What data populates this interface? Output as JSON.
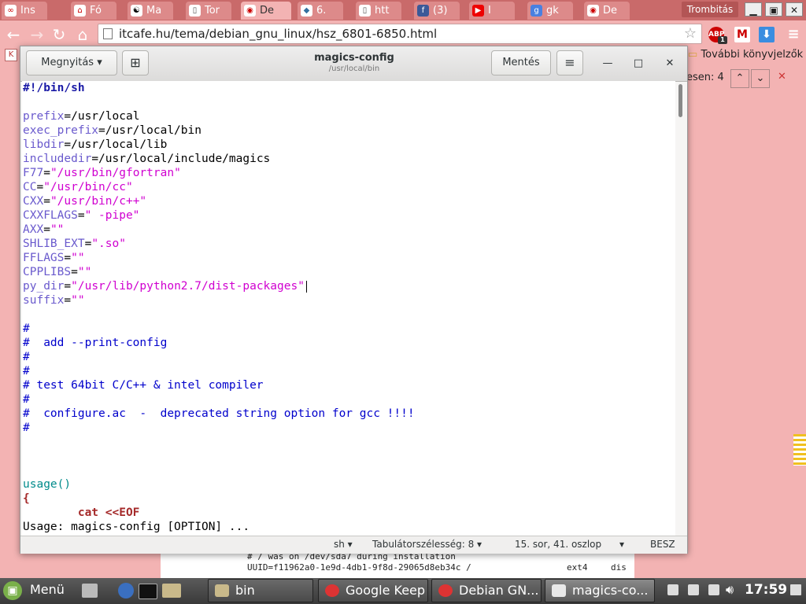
{
  "browser": {
    "tabs": [
      {
        "label": "Ins",
        "icon": "infinity-icon"
      },
      {
        "label": "Fó",
        "icon": "home-flag-icon"
      },
      {
        "label": "Ma",
        "icon": "debian-swirl-icon"
      },
      {
        "label": "Tor",
        "icon": "document-icon"
      },
      {
        "label": "De",
        "icon": "debian-icon"
      },
      {
        "label": "6.",
        "icon": "python-icon"
      },
      {
        "label": "htt",
        "icon": "document-icon"
      },
      {
        "label": "(3)",
        "icon": "facebook-icon"
      },
      {
        "label": "I",
        "icon": "youtube-icon"
      },
      {
        "label": "gk",
        "icon": "google-icon"
      },
      {
        "label": "De",
        "icon": "debian-icon"
      }
    ],
    "profile": "Trombitás",
    "url": "itcafe.hu/tema/debian_gnu_linux/hsz_6801-6850.html",
    "extensions": {
      "abp": "ABP",
      "abp_count": "1"
    },
    "bookmarks_label": "További könyvjelzők",
    "find_label": "esen: 4",
    "accent": "#f3b3b3"
  },
  "editor": {
    "open_button": "Megnyitás",
    "title": "magics-config",
    "subtitle": "/usr/local/bin",
    "save_button": "Mentés",
    "lines": [
      {
        "parts": [
          {
            "t": "#!/bin/sh",
            "c": "shebang"
          }
        ]
      },
      {
        "parts": []
      },
      {
        "parts": [
          {
            "t": "prefix",
            "c": "var"
          },
          {
            "t": "=/usr/local",
            "c": "plain"
          }
        ]
      },
      {
        "parts": [
          {
            "t": "exec_prefix",
            "c": "var"
          },
          {
            "t": "=/usr/local/bin",
            "c": "plain"
          }
        ]
      },
      {
        "parts": [
          {
            "t": "libdir",
            "c": "var"
          },
          {
            "t": "=/usr/local/lib",
            "c": "plain"
          }
        ]
      },
      {
        "parts": [
          {
            "t": "includedir",
            "c": "var"
          },
          {
            "t": "=/usr/local/include/magics",
            "c": "plain"
          }
        ]
      },
      {
        "parts": [
          {
            "t": "F77",
            "c": "var"
          },
          {
            "t": "=",
            "c": "plain"
          },
          {
            "t": "\"/usr/bin/gfortran\"",
            "c": "str"
          }
        ]
      },
      {
        "parts": [
          {
            "t": "CC",
            "c": "var"
          },
          {
            "t": "=",
            "c": "plain"
          },
          {
            "t": "\"/usr/bin/cc\"",
            "c": "str"
          }
        ]
      },
      {
        "parts": [
          {
            "t": "CXX",
            "c": "var"
          },
          {
            "t": "=",
            "c": "plain"
          },
          {
            "t": "\"/usr/bin/c++\"",
            "c": "str"
          }
        ]
      },
      {
        "parts": [
          {
            "t": "CXXFLAGS",
            "c": "var"
          },
          {
            "t": "=",
            "c": "plain"
          },
          {
            "t": "\" -pipe\"",
            "c": "str"
          }
        ]
      },
      {
        "parts": [
          {
            "t": "AXX",
            "c": "var"
          },
          {
            "t": "=",
            "c": "plain"
          },
          {
            "t": "\"\"",
            "c": "str"
          }
        ]
      },
      {
        "parts": [
          {
            "t": "SHLIB_EXT",
            "c": "var"
          },
          {
            "t": "=",
            "c": "plain"
          },
          {
            "t": "\".so\"",
            "c": "str"
          }
        ]
      },
      {
        "parts": [
          {
            "t": "FFLAGS",
            "c": "var"
          },
          {
            "t": "=",
            "c": "plain"
          },
          {
            "t": "\"\"",
            "c": "str"
          }
        ]
      },
      {
        "parts": [
          {
            "t": "CPPLIBS",
            "c": "var"
          },
          {
            "t": "=",
            "c": "plain"
          },
          {
            "t": "\"\"",
            "c": "str"
          }
        ]
      },
      {
        "parts": [
          {
            "t": "py_dir",
            "c": "var"
          },
          {
            "t": "=",
            "c": "plain"
          },
          {
            "t": "\"/usr/lib/python2.7/dist-packages\"",
            "c": "str"
          }
        ]
      },
      {
        "parts": [
          {
            "t": "suffix",
            "c": "var"
          },
          {
            "t": "=",
            "c": "plain"
          },
          {
            "t": "\"\"",
            "c": "str"
          }
        ]
      },
      {
        "parts": []
      },
      {
        "parts": [
          {
            "t": "#",
            "c": "com"
          }
        ]
      },
      {
        "parts": [
          {
            "t": "#  add --print-config",
            "c": "com"
          }
        ]
      },
      {
        "parts": [
          {
            "t": "#",
            "c": "com"
          }
        ]
      },
      {
        "parts": [
          {
            "t": "#",
            "c": "com"
          }
        ]
      },
      {
        "parts": [
          {
            "t": "# test 64bit C/C++ & intel compiler",
            "c": "com"
          }
        ]
      },
      {
        "parts": [
          {
            "t": "#",
            "c": "com"
          }
        ]
      },
      {
        "parts": [
          {
            "t": "#  configure.ac  -  deprecated string option for gcc !!!!",
            "c": "com"
          }
        ]
      },
      {
        "parts": [
          {
            "t": "#",
            "c": "com"
          }
        ]
      },
      {
        "parts": []
      },
      {
        "parts": []
      },
      {
        "parts": []
      },
      {
        "parts": [
          {
            "t": "usage()",
            "c": "fn"
          }
        ]
      },
      {
        "parts": [
          {
            "t": "{",
            "c": "brace"
          }
        ]
      },
      {
        "parts": [
          {
            "t": "        ",
            "c": "plain"
          },
          {
            "t": "cat <<EOF",
            "c": "kw"
          }
        ]
      },
      {
        "parts": [
          {
            "t": "Usage: magics-config [OPTION] ...",
            "c": "plain"
          }
        ]
      }
    ],
    "status": {
      "language": "sh",
      "tab_width": "Tabulátorszélesség: 8",
      "position": "15. sor, 41. oszlop",
      "mode": "BESZ"
    }
  },
  "terminal": {
    "line1": "# / was on /dev/sda7 during installation",
    "line2": "UUID=f11962a0-1e9d-4db1-9f8d-29065d8eb34c /",
    "fs": "ext4",
    "opt": "dis"
  },
  "taskbar": {
    "menu": "Menü",
    "tasks": [
      "bin",
      "Google Keep",
      "Debian GN...",
      "magics-co..."
    ],
    "clock": "17:59"
  }
}
